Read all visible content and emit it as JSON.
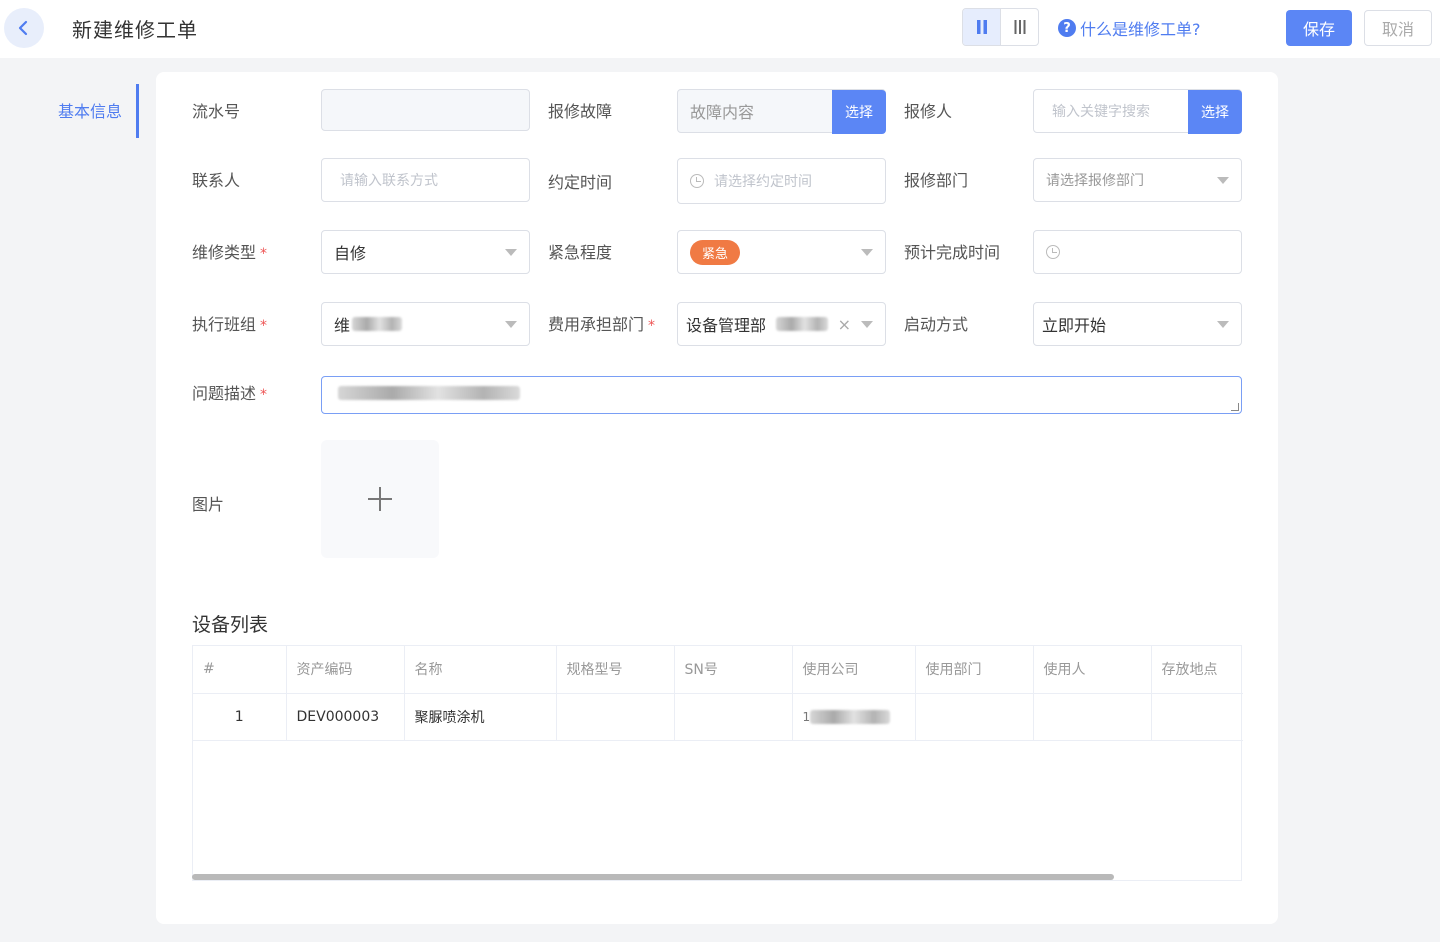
{
  "header": {
    "title": "新建维修工单",
    "help_text": "什么是维修工单?",
    "save_label": "保存",
    "cancel_label": "取消"
  },
  "nav": {
    "basic_info": "基本信息"
  },
  "form": {
    "serial_no": {
      "label": "流水号",
      "value": ""
    },
    "fault": {
      "label": "报修故障",
      "placeholder": "故障内容",
      "button": "选择"
    },
    "reporter": {
      "label": "报修人",
      "placeholder": "输入关键字搜索",
      "button": "选择"
    },
    "contact": {
      "label": "联系人",
      "placeholder": "请输入联系方式"
    },
    "appointment": {
      "label": "约定时间",
      "placeholder": "请选择约定时间"
    },
    "report_dept": {
      "label": "报修部门",
      "placeholder": "请选择报修部门"
    },
    "repair_type": {
      "label": "维修类型",
      "value": "自修",
      "required": "*"
    },
    "urgency": {
      "label": "紧急程度",
      "value": "紧急"
    },
    "est_finish": {
      "label": "预计完成时间",
      "value": ""
    },
    "team": {
      "label": "执行班组",
      "value": "维",
      "required": "*"
    },
    "cost_dept": {
      "label": "费用承担部门",
      "value": "设备管理部",
      "required": "*"
    },
    "start_mode": {
      "label": "启动方式",
      "value": "立即开始"
    },
    "description": {
      "label": "问题描述",
      "required": "*"
    },
    "images": {
      "label": "图片"
    }
  },
  "equipment": {
    "title": "设备列表",
    "columns": [
      "#",
      "资产编码",
      "名称",
      "规格型号",
      "SN号",
      "使用公司",
      "使用部门",
      "使用人",
      "存放地点"
    ],
    "rows": [
      {
        "index": "1",
        "asset_code": "DEV000003",
        "name": "聚脲喷涂机",
        "spec": "",
        "sn": "",
        "company": "1",
        "dept": "",
        "user": "",
        "location": ""
      }
    ]
  },
  "icons": [
    "back-arrow-icon",
    "layout-two-column-icon",
    "layout-three-column-icon",
    "help-icon",
    "clock-icon",
    "plus-icon",
    "dropdown-arrow-icon",
    "clear-icon"
  ],
  "colors": {
    "primary": "#5b86f5",
    "link": "#4f7cf0",
    "urgent": "#f07a44"
  }
}
